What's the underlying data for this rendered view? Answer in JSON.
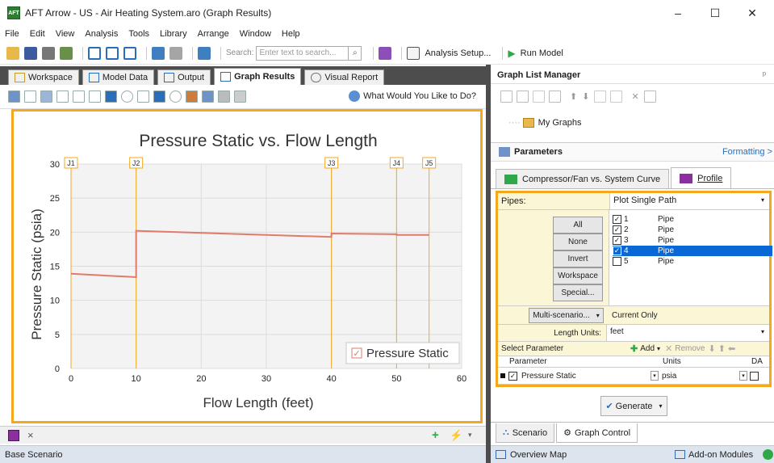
{
  "window": {
    "title": "AFT Arrow - US - Air Heating System.aro (Graph Results)",
    "app_icon_text": "AFT",
    "minimize": "–",
    "maximize": "☐",
    "close": "✕"
  },
  "menu": [
    "File",
    "Edit",
    "View",
    "Analysis",
    "Tools",
    "Library",
    "Arrange",
    "Window",
    "Help"
  ],
  "toolbar": {
    "search_label": "Search:",
    "search_placeholder": "Enter text to search...",
    "analysis_setup": "Analysis Setup...",
    "run_model": "Run Model"
  },
  "tabs": [
    {
      "label": "Workspace",
      "active": false
    },
    {
      "label": "Model Data",
      "active": false
    },
    {
      "label": "Output",
      "active": false
    },
    {
      "label": "Graph Results",
      "active": true
    },
    {
      "label": "Visual Report",
      "active": false
    }
  ],
  "graph_toolbar": {
    "help_text": "What Would You Like to Do?"
  },
  "chart_data": {
    "type": "line",
    "title": "Pressure Static vs. Flow Length",
    "xlabel": "Flow Length (feet)",
    "ylabel": "Pressure Static (psia)",
    "xlim": [
      0,
      60
    ],
    "ylim": [
      0,
      30
    ],
    "x_ticks": [
      0,
      10,
      20,
      30,
      40,
      50,
      60
    ],
    "y_ticks": [
      0,
      5,
      10,
      15,
      20,
      25,
      30
    ],
    "grid": true,
    "legend_position": "bottom-right",
    "series": [
      {
        "name": "Pressure Static",
        "color": "#e07b6a",
        "x": [
          0,
          10,
          10,
          40,
          40,
          50,
          50,
          55
        ],
        "y": [
          13.9,
          13.4,
          20.2,
          19.3,
          19.8,
          19.7,
          19.6,
          19.6
        ]
      }
    ],
    "junction_markers": [
      {
        "label": "J1",
        "x": 0
      },
      {
        "label": "J2",
        "x": 10
      },
      {
        "label": "J3",
        "x": 40
      },
      {
        "label": "J4",
        "x": 50
      },
      {
        "label": "J5",
        "x": 55
      }
    ],
    "marker_color": "#f5a81d"
  },
  "graph_status": {
    "close": "×"
  },
  "scenario_bar": {
    "text": "Base Scenario"
  },
  "right_panel": {
    "glm_title": "Graph List Manager",
    "glm_pin": "ᵖ",
    "tree_item": "My Graphs",
    "params_title": "Parameters",
    "formatting": "Formatting >",
    "ptabs": [
      {
        "label": "Compressor/Fan vs. System Curve",
        "active": false
      },
      {
        "label": "Profile",
        "active": true
      }
    ],
    "pipes_label": "Pipes:",
    "pipes_mode": "Plot Single Path",
    "buttons": [
      "All",
      "None",
      "Invert",
      "Workspace",
      "Special..."
    ],
    "pipes": [
      {
        "id": "1",
        "type": "Pipe",
        "checked": true,
        "selected": false
      },
      {
        "id": "2",
        "type": "Pipe",
        "checked": true,
        "selected": false
      },
      {
        "id": "3",
        "type": "Pipe",
        "checked": true,
        "selected": false
      },
      {
        "id": "4",
        "type": "Pipe",
        "checked": true,
        "selected": true
      },
      {
        "id": "5",
        "type": "Pipe",
        "checked": false,
        "selected": false
      }
    ],
    "multi_scenario": "Multi-scenario...",
    "current_only": "Current Only",
    "length_units_label": "Length Units:",
    "length_units": "feet",
    "select_param": "Select Parameter",
    "add": "Add",
    "remove": "Remove",
    "col_parameter": "Parameter",
    "col_units": "Units",
    "col_da": "DA",
    "param_row": {
      "name": "Pressure Static",
      "units": "psia"
    },
    "generate": "Generate",
    "bottom_tabs": [
      {
        "label": "Scenario",
        "active": false
      },
      {
        "label": "Graph Control",
        "active": true
      }
    ],
    "overview_map": "Overview Map",
    "addon_modules": "Add-on Modules"
  }
}
